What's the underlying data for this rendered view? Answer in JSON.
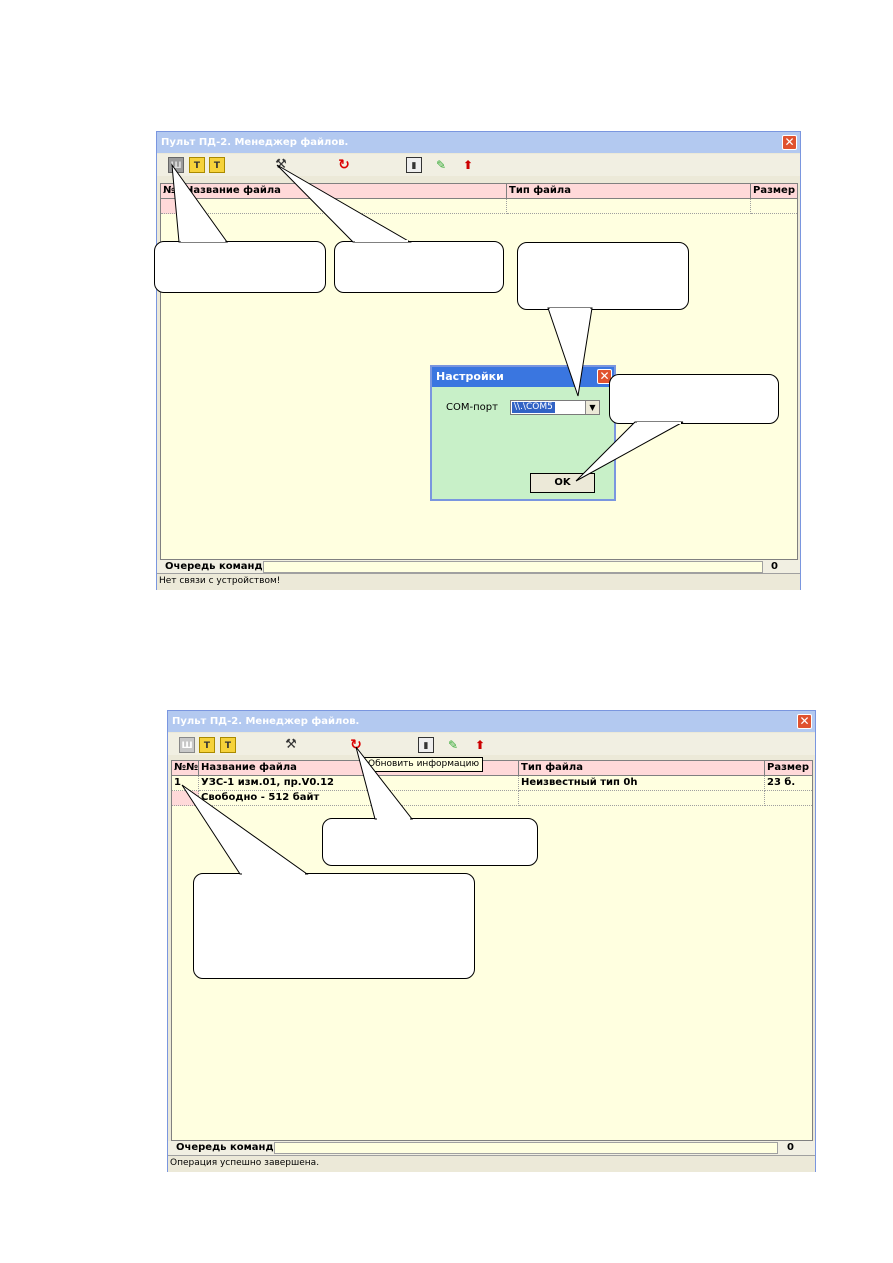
{
  "window1": {
    "title": "Пульт ПД-2. Менеджер файлов.",
    "columns": [
      "№",
      "Название файла",
      "Тип файла",
      "Размер"
    ],
    "queue_label": "Очередь команд:",
    "queue_count": "0",
    "status": "Нет связи с устройством!"
  },
  "settings_dialog": {
    "title": "Настройки",
    "port_label": "COM-порт",
    "port_value": "\\\\.\\COM5",
    "ok_label": "OK"
  },
  "window2": {
    "title": "Пульт ПД-2. Менеджер файлов.",
    "columns": [
      "№№",
      "Название файла",
      "Тип файла",
      "Размер"
    ],
    "rows": [
      {
        "num": "1",
        "name": "УЗС-1 изм.01, пр.V0.12",
        "type": "Неизвестный тип 0h",
        "size": "23 б."
      },
      {
        "num": "",
        "name": "Свободно - 512 байт",
        "type": "",
        "size": ""
      }
    ],
    "tooltip": "Обновить информацию",
    "queue_label": "Очередь команд:",
    "queue_count": "0",
    "status": "Операция успешно завершена."
  },
  "colors": {
    "pane": "#ffffe0",
    "header": "#ffd9d9",
    "dialog": "#c8f0c8",
    "titlebar": "#b3c9f0",
    "close": "#e0522f"
  }
}
